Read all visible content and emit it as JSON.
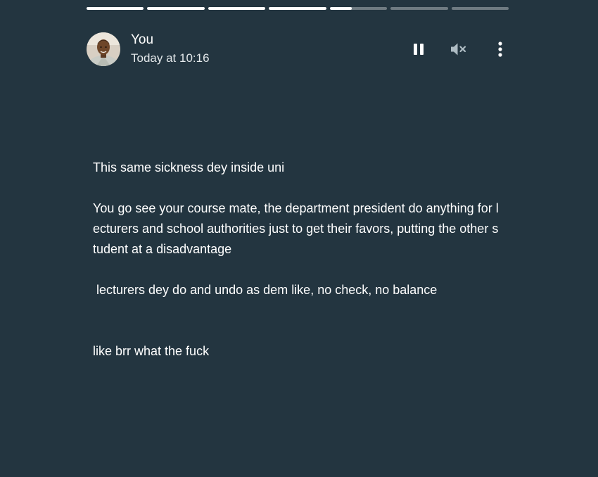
{
  "progress": {
    "segments": [
      {
        "fill": 1.0
      },
      {
        "fill": 1.0
      },
      {
        "fill": 1.0
      },
      {
        "fill": 1.0
      },
      {
        "fill": 0.38
      },
      {
        "fill": 0.0
      },
      {
        "fill": 0.0
      }
    ]
  },
  "header": {
    "author": "You",
    "timestamp": "Today at 10:16",
    "controls": {
      "pause_icon": "pause-icon",
      "mute_icon": "volume-muted-icon",
      "menu_icon": "more-vertical-icon"
    }
  },
  "story": {
    "text": "This same sickness dey inside uni\n\nYou go see your course mate, the department president do anything for lecturers and school authorities just to get their favors, putting the other student at a disadvantage\n\n lecturers dey do and undo as dem like, no check, no balance\n\n\nlike brr what the fuck"
  },
  "colors": {
    "background": "#233540",
    "text": "#ffffff",
    "progress_track": "rgba(255,255,255,0.35)",
    "progress_fill": "#ffffff"
  }
}
